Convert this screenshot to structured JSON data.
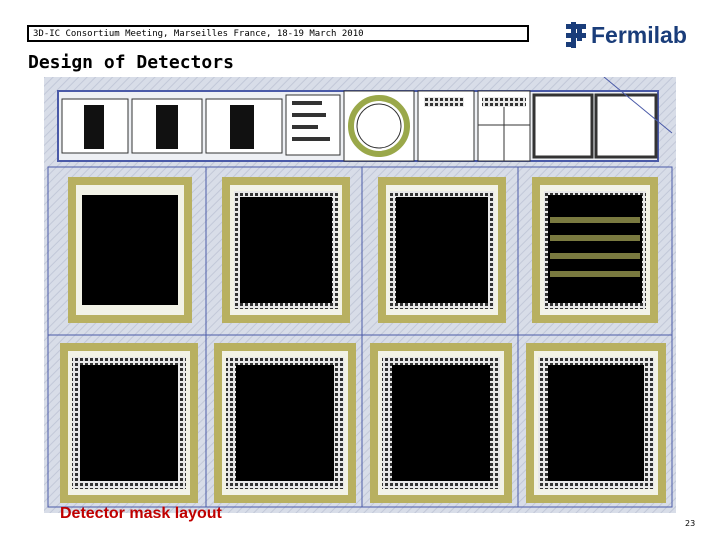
{
  "header": {
    "meeting": "3D-IC Consortium Meeting, Marseilles France, 18-19 March 2010"
  },
  "logo": {
    "text": "Fermilab",
    "icon": "fermilab-logo-icon"
  },
  "slide": {
    "title": "Design of Detectors",
    "caption": "Detector mask layout",
    "page_number": "23"
  },
  "colors": {
    "logo_blue": "#1a3d7a",
    "caption_red": "#c00000",
    "pad_ring_olive": "#b8b060",
    "layout_grid_blue": "#4a5aa8"
  }
}
